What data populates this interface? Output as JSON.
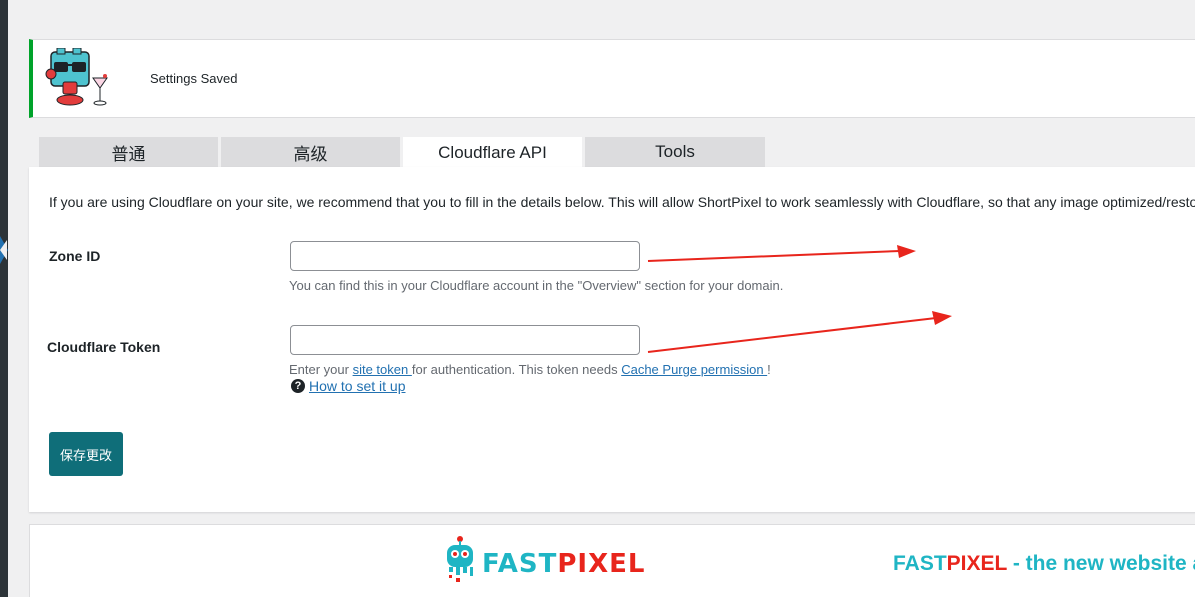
{
  "notice": {
    "message": "Settings Saved"
  },
  "tabs": [
    {
      "label": "普通",
      "active": false
    },
    {
      "label": "高级",
      "active": false
    },
    {
      "label": "Cloudflare API",
      "active": true
    },
    {
      "label": "Tools",
      "active": false
    }
  ],
  "panel": {
    "intro": "If you are using Cloudflare on your site, we recommend that you to fill in the details below. This will allow ShortPixel to work seamlessly with Cloudflare, so that any image optimized/resto",
    "zone_id": {
      "label": "Zone ID",
      "value": "",
      "description": "You can find this in your Cloudflare account in the \"Overview\" section for your domain."
    },
    "token": {
      "label": "Cloudflare Token",
      "value": "",
      "desc_prefix": "Enter your ",
      "desc_link1": "site token ",
      "desc_middle": "for authentication. This token needs ",
      "desc_link2": "Cache Purge permission ",
      "desc_suffix": "!",
      "help_icon": "?",
      "help_link": "How to set it up"
    },
    "save_label": "保存更改"
  },
  "banner": {
    "logo_part1": "FAST",
    "logo_part2": "PIXEL",
    "tagline_part1": "FAST",
    "tagline_part2": "PIXEL",
    "tagline_rest": " - the new website a"
  },
  "colors": {
    "notice_accent": "#00a32a",
    "link": "#2271b1",
    "save_button": "#0f6e79",
    "arrow": "#e8251c",
    "fastpixel_teal": "#1fb5c4",
    "fastpixel_red": "#e8251c"
  }
}
